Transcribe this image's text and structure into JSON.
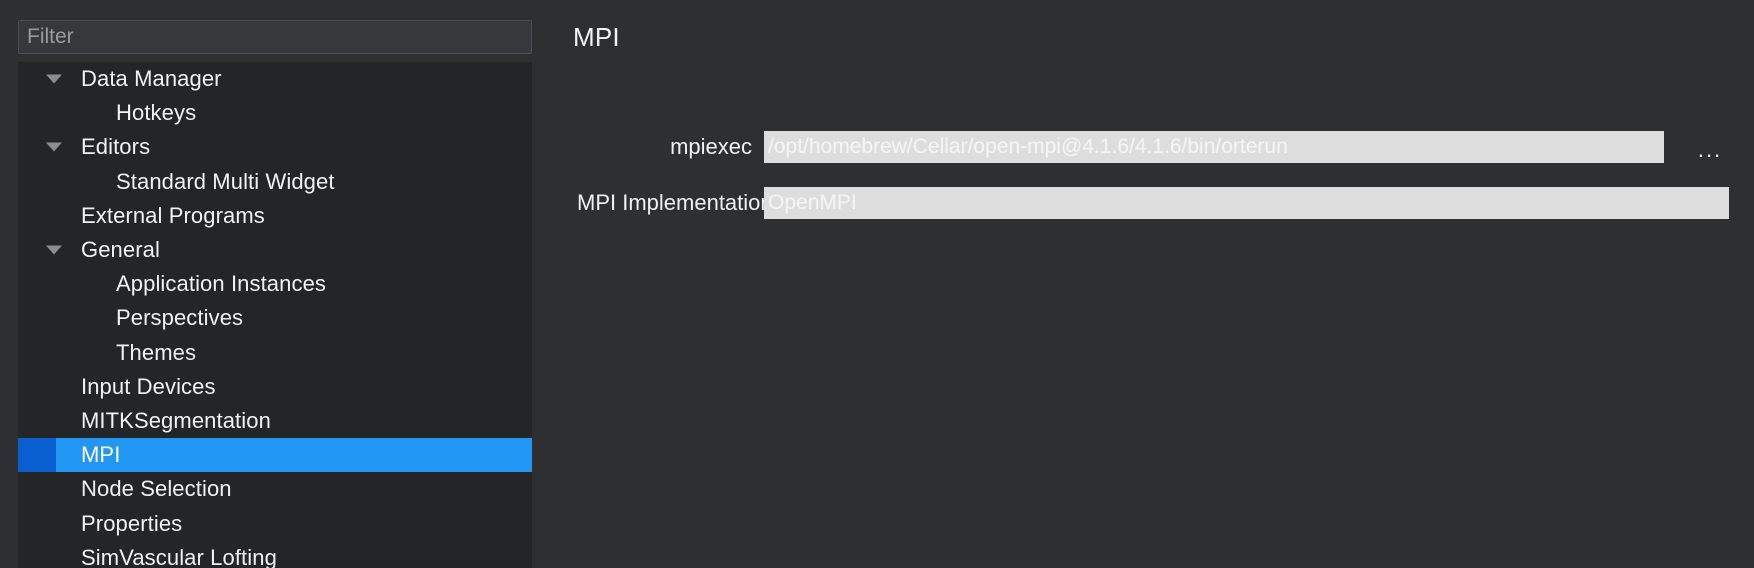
{
  "colors": {
    "window_bg": "#2e2f31",
    "tree_bg": "#242527",
    "selection": "#2196f3",
    "selection_accent": "#0a5fd0",
    "field_bg": "#dddddd",
    "field_text": "#f4f4f4",
    "text": "#f2f2f2"
  },
  "sidebar": {
    "filter": {
      "placeholder": "Filter",
      "value": ""
    },
    "items": [
      {
        "label": "Data Manager",
        "level": 0,
        "expandable": true,
        "expanded": true,
        "selected": false
      },
      {
        "label": "Hotkeys",
        "level": 1,
        "expandable": false,
        "expanded": false,
        "selected": false
      },
      {
        "label": "Editors",
        "level": 0,
        "expandable": true,
        "expanded": true,
        "selected": false
      },
      {
        "label": "Standard Multi Widget",
        "level": 1,
        "expandable": false,
        "expanded": false,
        "selected": false
      },
      {
        "label": "External Programs",
        "level": 0,
        "expandable": false,
        "expanded": false,
        "selected": false
      },
      {
        "label": "General",
        "level": 0,
        "expandable": true,
        "expanded": true,
        "selected": false
      },
      {
        "label": "Application Instances",
        "level": 1,
        "expandable": false,
        "expanded": false,
        "selected": false
      },
      {
        "label": "Perspectives",
        "level": 1,
        "expandable": false,
        "expanded": false,
        "selected": false
      },
      {
        "label": "Themes",
        "level": 1,
        "expandable": false,
        "expanded": false,
        "selected": false
      },
      {
        "label": "Input Devices",
        "level": 0,
        "expandable": false,
        "expanded": false,
        "selected": false
      },
      {
        "label": "MITKSegmentation",
        "level": 0,
        "expandable": false,
        "expanded": false,
        "selected": false
      },
      {
        "label": "MPI",
        "level": 0,
        "expandable": false,
        "expanded": false,
        "selected": true
      },
      {
        "label": "Node Selection",
        "level": 0,
        "expandable": false,
        "expanded": false,
        "selected": false
      },
      {
        "label": "Properties",
        "level": 0,
        "expandable": false,
        "expanded": false,
        "selected": false
      },
      {
        "label": "SimVascular Lofting",
        "level": 0,
        "expandable": false,
        "expanded": false,
        "selected": false
      }
    ]
  },
  "content": {
    "title": "MPI",
    "fields": {
      "mpiexec": {
        "label": "mpiexec",
        "value": "/opt/homebrew/Cellar/open-mpi@4.1.6/4.1.6/bin/orterun",
        "browse_label": "..."
      },
      "implementation": {
        "label": "MPI Implementation",
        "value": "OpenMPI"
      }
    }
  }
}
